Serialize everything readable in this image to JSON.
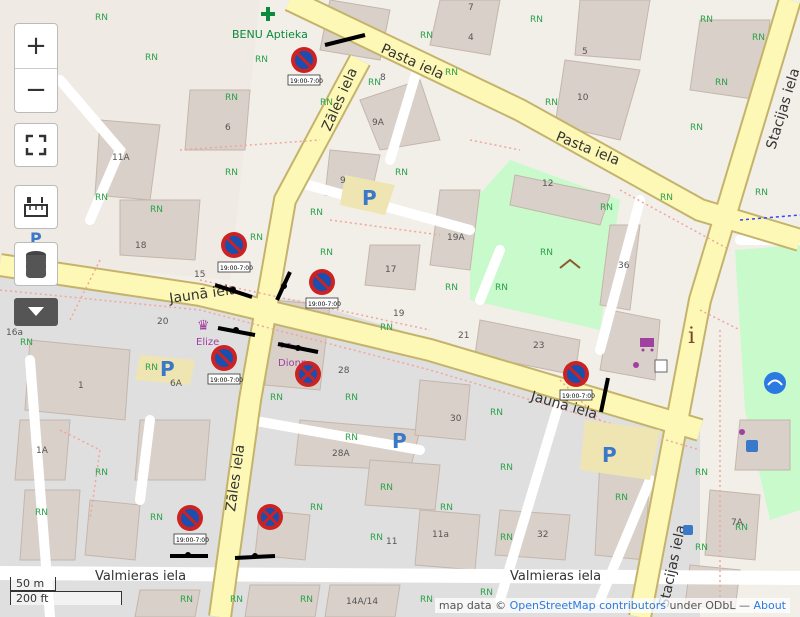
{
  "controls": {
    "zoom_in": "+",
    "zoom_out": "−"
  },
  "map": {
    "streets": {
      "pasta": "Pasta iela",
      "pasta2": "Pasta iela",
      "stacijas": "Stacijas iela",
      "stacijas2": "Stacijas iela",
      "zales": "Zāles iela",
      "zales2": "Zāles iela",
      "jauna": "Jaunā iela",
      "jauna2": "Jaunā iela",
      "valmieras": "Valmieras iela",
      "valmieras2": "Valmieras iela"
    },
    "pharmacy": "BENU Aptieka",
    "shop1": "Elize",
    "shop2": "Dionn",
    "rn": "RN",
    "parking": "P",
    "info": "i",
    "house_numbers": [
      "1",
      "1A",
      "4",
      "5",
      "6",
      "6A",
      "7",
      "7A",
      "8",
      "9",
      "9A",
      "10",
      "11",
      "11A",
      "11a",
      "12",
      "14A/14",
      "15",
      "16a",
      "17",
      "18",
      "19",
      "19A",
      "20",
      "21",
      "23",
      "28",
      "28A",
      "30",
      "32",
      "36"
    ],
    "sign_time": "19:00-7:00"
  },
  "scale": {
    "metric": "50 m",
    "imperial": "200 ft"
  },
  "attribution": {
    "prefix": "map data ©",
    "link": "OpenStreetMap contributors",
    "middle": "under ODbL —",
    "about": "About"
  }
}
